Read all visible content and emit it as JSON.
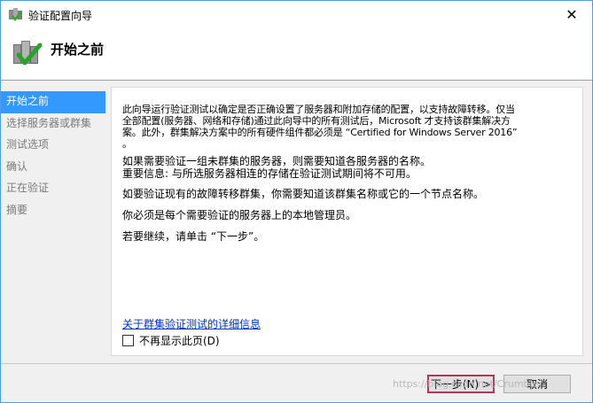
{
  "window": {
    "title": "验证配置向导",
    "close_glyph": "✕"
  },
  "header": {
    "heading": "开始之前",
    "icon": "cluster-validate-icon"
  },
  "nav": {
    "items": [
      {
        "label": "开始之前",
        "active": true
      },
      {
        "label": "选择服务器或群集",
        "active": false
      },
      {
        "label": "测试选项",
        "active": false
      },
      {
        "label": "确认",
        "active": false
      },
      {
        "label": "正在验证",
        "active": false
      },
      {
        "label": "摘要",
        "active": false
      }
    ]
  },
  "content": {
    "para1_line1": "此向导运行验证测试以确定是否正确设置了服务器和附加存储的配置，以支持故障转移。仅当",
    "para1_line2": "全部配置(服务器、网络和存储)通过此向导中的所有测试后，Microsoft 才支持该群集解决方",
    "para1_line3": "案。此外，群集解决方案中的所有硬件组件都必须是 “Certified for Windows Server 2016”",
    "para1_line4": "。",
    "para2_line1": "如果需要验证一组未群集的服务器，则需要知道各服务器的名称。",
    "para2_line2": "重要信息: 与所选服务器相连的存储在验证测试期间将不可用。",
    "para3": "如要验证现有的故障转移群集，你需要知道该群集名称或它的一个节点名称。",
    "para4": "你必须是每个需要验证的服务器上的本地管理员。",
    "para5": "若要继续，请单击 “下一步”。",
    "link": "关于群集验证测试的详细信息",
    "checkbox_label": "不再显示此页(D)",
    "checkbox_checked": false
  },
  "footer": {
    "next_label": "下一步(N) >",
    "cancel_label": "取消"
  },
  "watermark": "https://blog.csdn.net/Crumble"
}
